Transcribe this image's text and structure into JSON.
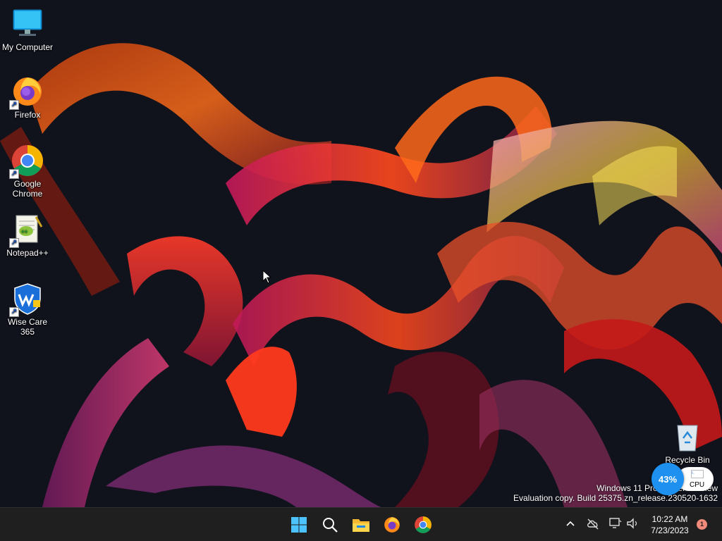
{
  "desktop": {
    "icons": [
      {
        "label": "My Computer"
      },
      {
        "label": "Firefox"
      },
      {
        "label": "Google\nChrome"
      },
      {
        "label": "Notepad++"
      },
      {
        "label": "Wise Care 365"
      },
      {
        "label": "Recycle Bin"
      }
    ],
    "watermark": {
      "line1": "Windows 11 Pro Insider Preview",
      "line2": "Evaluation copy. Build 25375.zn_release.230520-1632"
    },
    "cpu_widget": {
      "percent": "43%",
      "label": "CPU"
    }
  },
  "taskbar": {
    "apps": [
      {
        "icon": "windows-start-icon"
      },
      {
        "icon": "search-icon"
      },
      {
        "icon": "file-explorer-icon"
      },
      {
        "icon": "firefox-icon"
      },
      {
        "icon": "chrome-icon"
      }
    ],
    "tray": {
      "time": "10:22 AM",
      "date": "7/23/2023",
      "notification_count": "1"
    }
  },
  "colors": {
    "taskbar_bg": "#1f1f1f",
    "accent": "#1e90f0",
    "wallpaper_bg": "#10121c"
  }
}
